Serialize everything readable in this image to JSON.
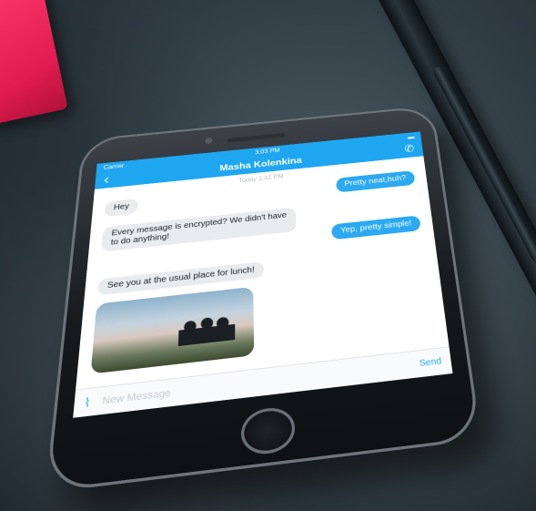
{
  "status_bar": {
    "carrier": "Carrier",
    "time": "3:03 PM"
  },
  "chat": {
    "title": "Masha Kolenkina",
    "date_label": "Today 1:41 PM",
    "messages": [
      {
        "dir": "in",
        "text": "Hey"
      },
      {
        "dir": "out",
        "text": "Pretty neat,huh?"
      },
      {
        "dir": "in",
        "text": "Every message is encrypted? We didn't have to do anything!"
      },
      {
        "dir": "out",
        "text": "Yep, pretty simple!"
      },
      {
        "dir": "in",
        "text": "See you at the usual place for lunch!"
      }
    ]
  },
  "composer": {
    "placeholder": "New Message",
    "send_label": "Send"
  },
  "icons": {
    "back": "chevron-left-icon",
    "call": "phone-icon",
    "attach": "paperclip-icon"
  },
  "colors": {
    "accent": "#1fa6f0",
    "book": "#e01b4f"
  }
}
